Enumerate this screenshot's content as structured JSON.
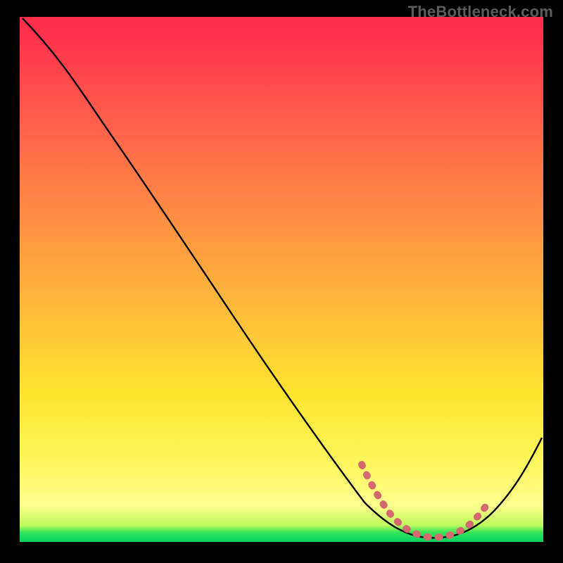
{
  "watermark": "TheBottleneck.com",
  "chart_data": {
    "type": "line",
    "title": "",
    "xlabel": "",
    "ylabel": "",
    "xlim": [
      0,
      100
    ],
    "ylim": [
      0,
      100
    ],
    "series": [
      {
        "name": "bottleneck-curve",
        "x": [
          0,
          10,
          20,
          30,
          40,
          50,
          60,
          67,
          72,
          76,
          80,
          84,
          88,
          92,
          100
        ],
        "y": [
          100,
          91,
          80,
          67,
          54,
          41,
          28,
          16,
          7,
          3,
          1.5,
          1.5,
          3,
          7,
          20
        ],
        "color": "#000000"
      },
      {
        "name": "optimal-range-marker",
        "x": [
          67,
          70,
          73,
          76,
          79,
          81,
          83,
          85,
          87,
          89
        ],
        "y": [
          15,
          9.5,
          6,
          3.2,
          2.0,
          1.6,
          1.6,
          2.2,
          3.6,
          5.8
        ],
        "color": "#d46a6f"
      }
    ],
    "gradient_stops": [
      {
        "pos": 0,
        "color": "#ff2b4a"
      },
      {
        "pos": 0.32,
        "color": "#ff7e46"
      },
      {
        "pos": 0.6,
        "color": "#ffc637"
      },
      {
        "pos": 0.85,
        "color": "#fef65e"
      },
      {
        "pos": 0.97,
        "color": "#bffb5d"
      },
      {
        "pos": 1.0,
        "color": "#00d564"
      }
    ]
  }
}
